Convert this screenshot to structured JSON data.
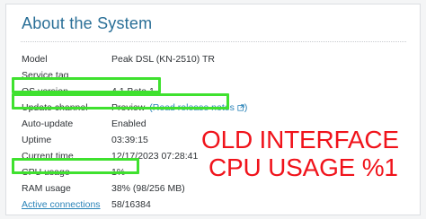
{
  "panel": {
    "title": "About the System",
    "rows": [
      {
        "label": "Model",
        "value": "Peak DSL (KN-2510) TR"
      },
      {
        "label": "Service tag",
        "value": ""
      },
      {
        "label": "OS version",
        "value": "4.1 Beta 1"
      },
      {
        "label": "Update channel",
        "value": "Preview",
        "link": "Read release notes"
      },
      {
        "label": "Auto-update",
        "value": "Enabled"
      },
      {
        "label": "Uptime",
        "value": "03:39:15"
      },
      {
        "label": "Current time",
        "value": "12/17/2023 07:28:41"
      },
      {
        "label": "CPU usage",
        "value": "1%"
      },
      {
        "label": "RAM usage",
        "value": "38% (98/256 MB)"
      },
      {
        "label": "Active connections",
        "value": "58/16384"
      }
    ]
  },
  "overlay": {
    "line1": "OLD INTERFACE",
    "line2": "CPU USAGE %1"
  },
  "colors": {
    "title": "#2a6f97",
    "link": "#2a83b8",
    "highlight": "#3fe12f",
    "overlay_text": "#f0131b"
  }
}
